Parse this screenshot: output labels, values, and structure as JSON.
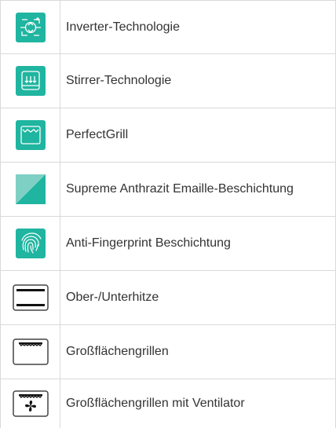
{
  "features": [
    {
      "label": "Inverter-Technologie",
      "icon": "inverter-icon"
    },
    {
      "label": "Stirrer-Technologie",
      "icon": "stirrer-icon"
    },
    {
      "label": "PerfectGrill",
      "icon": "perfect-grill-icon"
    },
    {
      "label": "Supreme Anthrazit Emaille-Beschichtung",
      "icon": "anthracite-enamel-icon"
    },
    {
      "label": "Anti-Fingerprint Beschichtung",
      "icon": "fingerprint-icon"
    },
    {
      "label": "Ober-/Unterhitze",
      "icon": "top-bottom-heat-icon"
    },
    {
      "label": "Großflächengrillen",
      "icon": "large-grill-icon"
    },
    {
      "label": "Großflächengrillen mit Ventilator",
      "icon": "grill-fan-icon"
    }
  ],
  "colors": {
    "teal": "#1fb5a0",
    "teal_light": "#7fd0c4",
    "border": "#d9d9d9",
    "text": "#333333"
  }
}
